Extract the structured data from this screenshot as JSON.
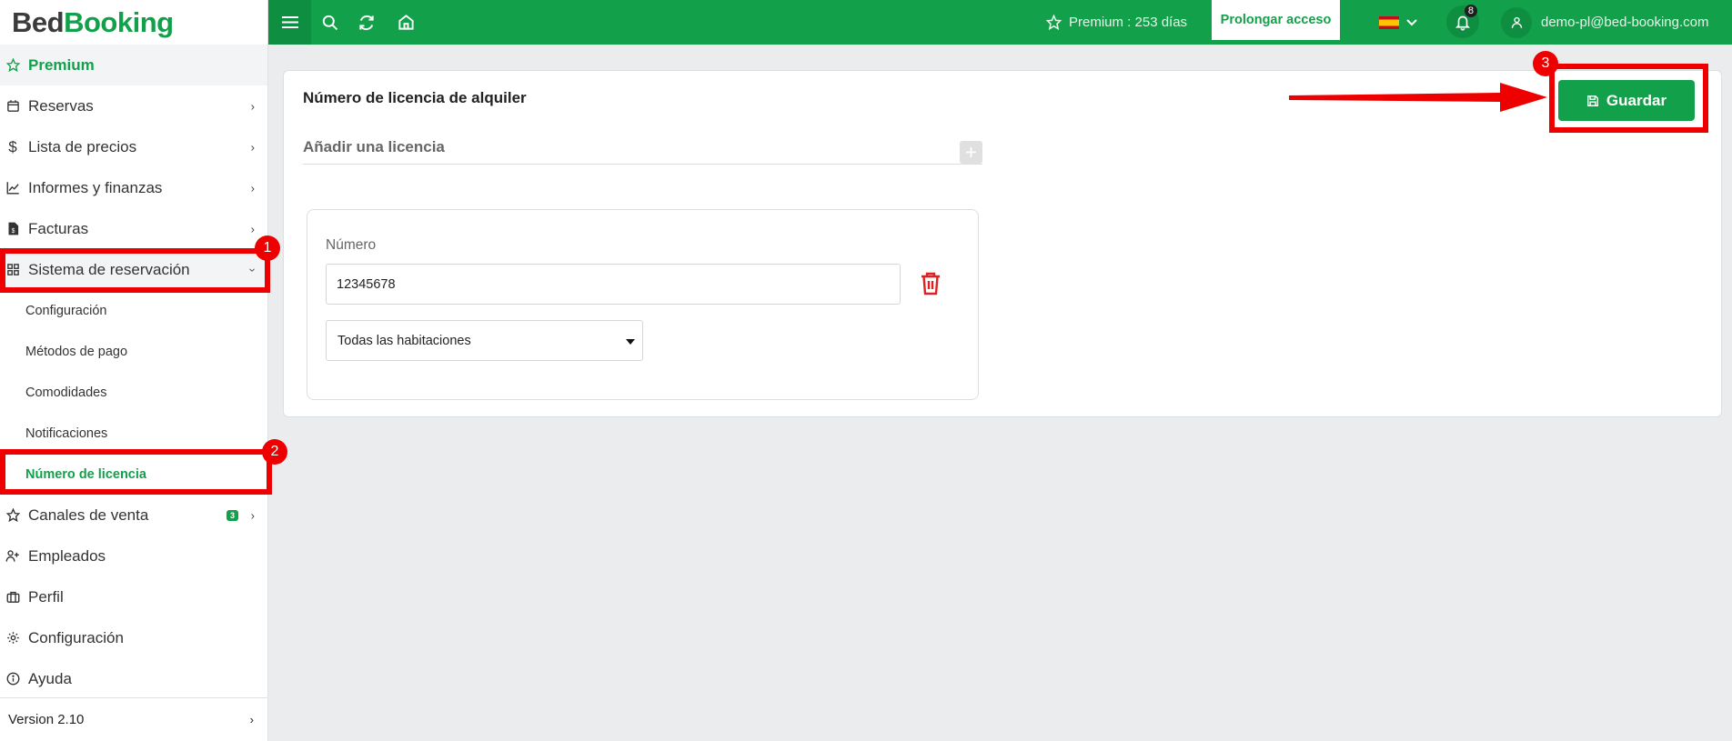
{
  "logo": {
    "part1": "Bed",
    "part2": "Booking"
  },
  "sidebar": {
    "items": [
      {
        "label": "Premium"
      },
      {
        "label": "Reservas"
      },
      {
        "label": "Lista de precios"
      },
      {
        "label": "Informes y finanzas"
      },
      {
        "label": "Facturas"
      },
      {
        "label": "Sistema de reservación"
      }
    ],
    "subitems": [
      {
        "label": "Configuración"
      },
      {
        "label": "Métodos de pago"
      },
      {
        "label": "Comodidades"
      },
      {
        "label": "Notificaciones"
      },
      {
        "label": "Número de licencia"
      }
    ],
    "items_after": [
      {
        "label": "Canales de venta",
        "badge": "3"
      },
      {
        "label": "Empleados"
      },
      {
        "label": "Perfil"
      },
      {
        "label": "Configuración"
      },
      {
        "label": "Ayuda"
      }
    ],
    "version": "Version 2.10"
  },
  "topbar": {
    "premium_text": "Premium : 253 días",
    "prolongar": "Prolongar acceso",
    "notifications": "8",
    "user_email": "demo-pl@bed-booking.com"
  },
  "card": {
    "title": "Número de licencia de alquiler",
    "save_label": "Guardar",
    "add_label": "Añadir una licencia",
    "number_label": "Número",
    "number_value": "12345678",
    "rooms_select": "Todas las habitaciones"
  },
  "annotations": {
    "n1": "1",
    "n2": "2",
    "n3": "3"
  },
  "colors": {
    "brand": "#12a14a",
    "annotation": "#ee0000",
    "delete": "#e02020"
  }
}
